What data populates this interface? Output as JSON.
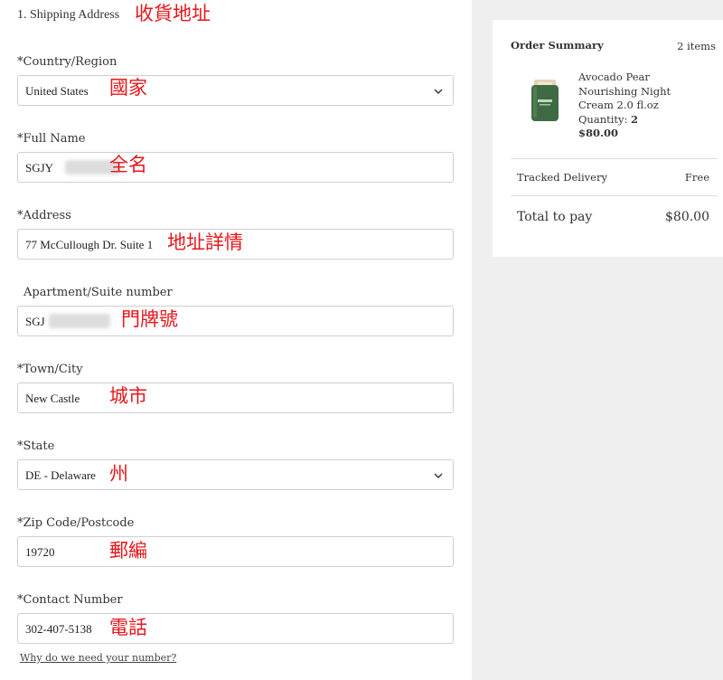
{
  "shipping": {
    "section_title": "1. Shipping Address",
    "section_note": "收貨地址",
    "fields": [
      {
        "label": "*Country/Region",
        "value": "United States",
        "note": "國家"
      },
      {
        "label": "*Full Name",
        "value": "SGJY",
        "note": "全名"
      },
      {
        "label": "*Address",
        "value": "77 McCullough Dr. Suite 1",
        "note": "地址詳情"
      },
      {
        "label": "Apartment/Suite number",
        "value": "SGJ",
        "note": "門牌號"
      },
      {
        "label": "*Town/City",
        "value": "New Castle",
        "note": "城市"
      },
      {
        "label": "*State",
        "value": "DE - Delaware",
        "note": "州"
      },
      {
        "label": "*Zip Code/Postcode",
        "value": "19720",
        "note": "郵編"
      },
      {
        "label": "*Contact Number",
        "value": "302-407-5138",
        "note": "電話"
      }
    ],
    "help_link": "Why do we need your number?"
  },
  "order_summary": {
    "title": "Order Summary",
    "item_count": "2 items",
    "product": {
      "name_line1": "Avocado Pear",
      "name_line2": "Nourishing Night",
      "name_line3": "Cream 2.0 fl.oz",
      "quantity_label": "Quantity:",
      "quantity_value": "2",
      "price": "$80.00"
    },
    "delivery_label": "Tracked Delivery",
    "delivery_value": "Free",
    "total_label": "Total to pay",
    "total_value": "$80.00"
  },
  "colors": {
    "annotation": "#e8161b",
    "page_background": "#efefef",
    "jar_green": "#3f6b43"
  }
}
